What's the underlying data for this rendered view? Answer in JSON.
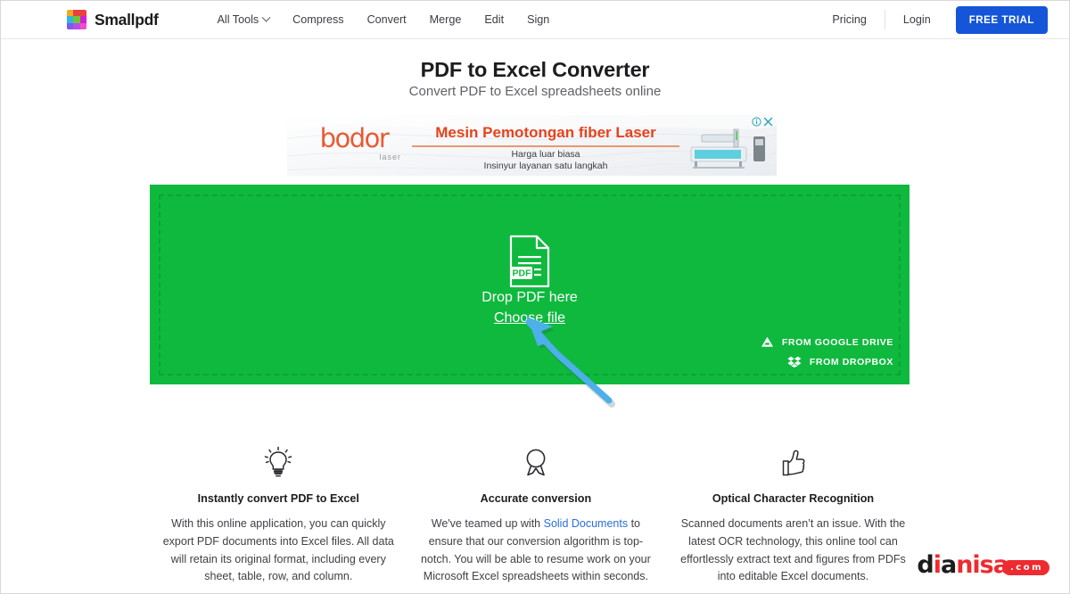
{
  "header": {
    "brand_name": "Smallpdf",
    "logo_colors": [
      "#f5a623",
      "#e8413f",
      "#e8413f",
      "#2fb5e8",
      "#6fc72e",
      "#d21fd2",
      "#7b5cf0",
      "#b84cf0",
      "#f04cc8"
    ],
    "nav_items": [
      {
        "label": "All Tools",
        "has_chevron": true
      },
      {
        "label": "Compress",
        "has_chevron": false
      },
      {
        "label": "Convert",
        "has_chevron": false
      },
      {
        "label": "Merge",
        "has_chevron": false
      },
      {
        "label": "Edit",
        "has_chevron": false
      },
      {
        "label": "Sign",
        "has_chevron": false
      }
    ],
    "pricing_label": "Pricing",
    "login_label": "Login",
    "free_trial_label": "FREE TRIAL",
    "free_trial_color": "#1555d8"
  },
  "hero": {
    "title": "PDF to Excel Converter",
    "subtitle": "Convert PDF to Excel spreadsheets online"
  },
  "ad": {
    "logo_text": "bodor",
    "logo_sub": "laser",
    "headline": "Mesin Pemotongan fiber Laser",
    "line1": "Harga luar biasa",
    "line2": "Insinyur layanan satu langkah",
    "adchoices_icon": "info-icon",
    "close_icon": "close-icon",
    "icon_color": "#2aa6b8"
  },
  "dropzone": {
    "background_color": "#0fb93e",
    "border_color": "#0aa534",
    "file_icon": "pdf-file-icon",
    "icon_badge_label": "PDF",
    "drop_text": "Drop PDF here",
    "choose_file_label": "Choose file",
    "google_drive_label": "FROM GOOGLE DRIVE",
    "google_drive_icon": "google-drive-icon",
    "dropbox_label": "FROM DROPBOX",
    "dropbox_icon": "dropbox-icon"
  },
  "annotation": {
    "arrow_color": "#4db0e8",
    "arrow_points_to": "Choose file"
  },
  "features": [
    {
      "icon": "lightbulb-icon",
      "title": "Instantly convert PDF to Excel",
      "body_before": "With this online application, you can quickly export PDF documents into Excel files. All data will retain its original format, including every sheet, table, row, and column.",
      "link_text": "",
      "body_after": ""
    },
    {
      "icon": "award-medal-icon",
      "title": "Accurate conversion",
      "body_before": "We've teamed up with ",
      "link_text": "Solid Documents",
      "body_after": " to ensure that our conversion algorithm is top-notch. You will be able to resume work on your Microsoft Excel spreadsheets within seconds."
    },
    {
      "icon": "thumbs-up-icon",
      "title": "Optical Character Recognition",
      "body_before": "Scanned documents aren’t an issue. With the latest OCR technology, this online tool can effortlessly extract text and figures from PDFs into editable Excel documents.",
      "link_text": "",
      "body_after": ""
    }
  ],
  "watermark": {
    "part_d": "d",
    "part_i": "i",
    "part_a": "a",
    "part_rest": "nisa",
    "part_com": ".com",
    "color": "#ee2b30"
  }
}
